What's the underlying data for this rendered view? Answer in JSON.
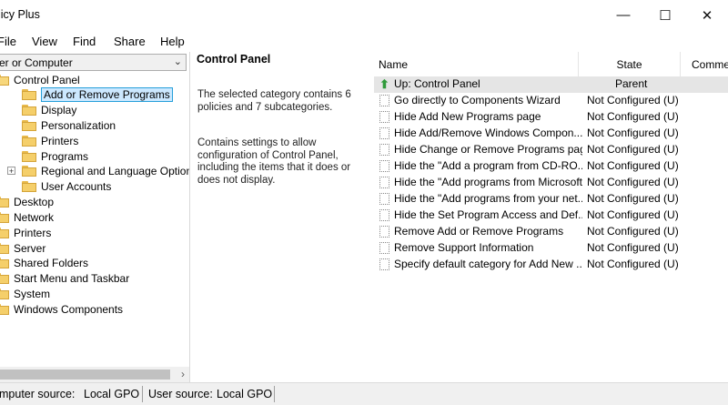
{
  "window": {
    "title": "licy Plus",
    "controls": {
      "minimize": "—",
      "maximize": "☐",
      "close": "✕"
    }
  },
  "menu": [
    "File",
    "View",
    "Find",
    "Share",
    "Help"
  ],
  "scope_selector": {
    "value": "er or Computer"
  },
  "tree": {
    "root": "Control Panel",
    "children": [
      {
        "label": "Add or Remove Programs",
        "selected": true
      },
      {
        "label": "Display"
      },
      {
        "label": "Personalization"
      },
      {
        "label": "Printers"
      },
      {
        "label": "Programs"
      },
      {
        "label": "Regional and Language Options",
        "expandable": true
      },
      {
        "label": "User Accounts"
      }
    ],
    "siblings": [
      "Desktop",
      "Network",
      "Printers",
      "Server",
      "Shared Folders",
      "Start Menu and Taskbar",
      "System",
      "Windows Components"
    ]
  },
  "category_panel": {
    "heading": "Control Panel",
    "summary_lines": [
      "The selected category contains 6",
      "policies and 7 subcategories."
    ],
    "description_lines": [
      "Contains settings to allow",
      "configuration of Control Panel,",
      "including the items that it does or",
      "does not display."
    ]
  },
  "policy_list": {
    "columns": {
      "name": "Name",
      "state": "State",
      "comment": "Commer"
    },
    "rows": [
      {
        "name": "Up: Control Panel",
        "state": "Parent",
        "icon": "up-arrow-icon"
      },
      {
        "name": "Go directly to Components Wizard",
        "state": "Not Configured (U)"
      },
      {
        "name": "Hide Add New Programs page",
        "state": "Not Configured (U)"
      },
      {
        "name": "Hide Add/Remove Windows Compon...",
        "state": "Not Configured (U)"
      },
      {
        "name": "Hide Change or Remove Programs page",
        "state": "Not Configured (U)"
      },
      {
        "name": "Hide the \"Add a program from CD-RO...",
        "state": "Not Configured (U)"
      },
      {
        "name": "Hide the \"Add programs from Microsoft...",
        "state": "Not Configured (U)"
      },
      {
        "name": "Hide the \"Add programs from your net...",
        "state": "Not Configured (U)"
      },
      {
        "name": "Hide the Set Program Access and Def...",
        "state": "Not Configured (U)"
      },
      {
        "name": "Remove Add or Remove Programs",
        "state": "Not Configured (U)"
      },
      {
        "name": "Remove Support Information",
        "state": "Not Configured (U)"
      },
      {
        "name": "Specify default category for Add New ...",
        "state": "Not Configured (U)"
      }
    ]
  },
  "status": {
    "computer_label": "mputer source:",
    "computer_value": "Local GPO",
    "user_label": "User source:",
    "user_value": "Local GPO"
  },
  "colors": {
    "selection_bg": "#cce8ff",
    "selection_border": "#26a0da",
    "row_highlight": "#e5e5e5",
    "folder": "#f5cf6a"
  }
}
